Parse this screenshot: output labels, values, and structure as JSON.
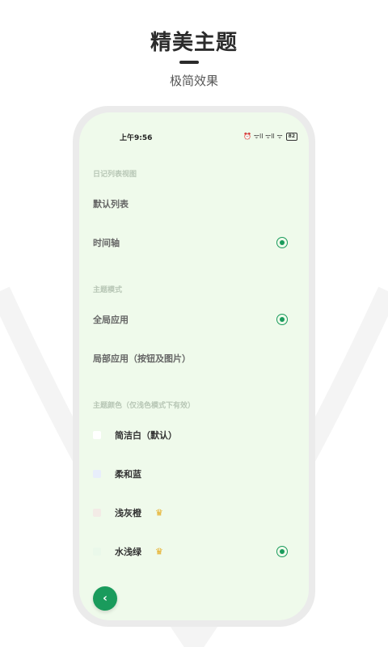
{
  "hero": {
    "title": "精美主题",
    "subtitle": "极简效果"
  },
  "status_bar": {
    "time": "上午9:56",
    "signal_icons": "⏰ ᯤll ᯤll ᯤ",
    "battery": "82"
  },
  "sections": {
    "diary_list": {
      "label": "日记列表视图",
      "options": [
        {
          "label": "默认列表",
          "selected": false
        },
        {
          "label": "时间轴",
          "selected": true
        }
      ]
    },
    "theme_mode": {
      "label": "主题模式",
      "options": [
        {
          "label": "全局应用",
          "selected": true
        },
        {
          "label": "局部应用（按钮及图片）",
          "selected": false
        }
      ]
    },
    "theme_color": {
      "label": "主题颜色（仅浅色模式下有效）",
      "options": [
        {
          "label": "简洁白（默认）",
          "swatch": "#ffffff",
          "premium": false,
          "selected": false
        },
        {
          "label": "柔和蓝",
          "swatch": "#e8eefb",
          "premium": false,
          "selected": false
        },
        {
          "label": "浅灰橙",
          "swatch": "#f3ebe6",
          "premium": true,
          "selected": false
        },
        {
          "label": "水浅绿",
          "swatch": "#eaf8ea",
          "premium": true,
          "selected": true
        }
      ]
    }
  },
  "colors": {
    "accent": "#1a9b5c",
    "screen_bg": "#effaeb",
    "crown": "#e6a817"
  },
  "icons": {
    "crown": "crown-icon",
    "back": "chevron-left-icon"
  },
  "back_button": {
    "glyph": "‹"
  }
}
